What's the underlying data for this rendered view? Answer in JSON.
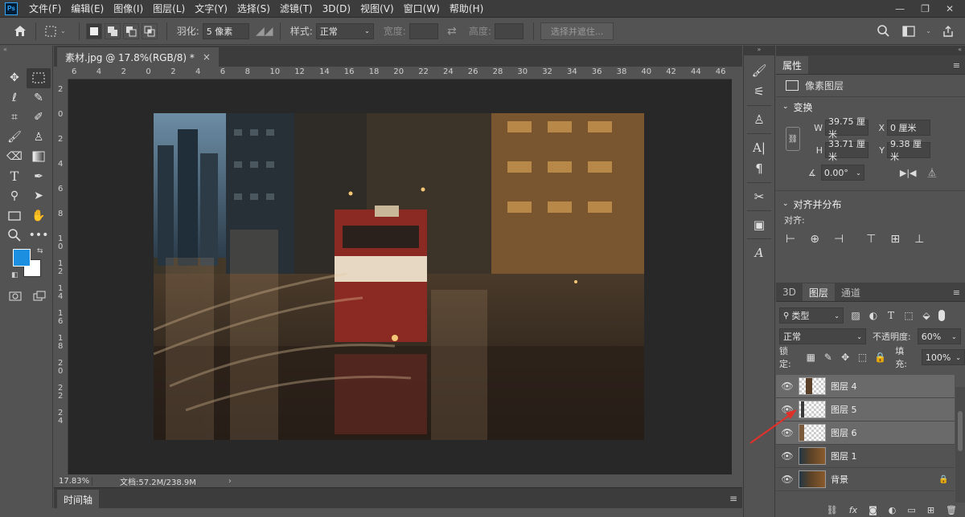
{
  "menubar": {
    "logo": "Ps",
    "items": [
      "文件(F)",
      "编辑(E)",
      "图像(I)",
      "图层(L)",
      "文字(Y)",
      "选择(S)",
      "滤镜(T)",
      "3D(D)",
      "视图(V)",
      "窗口(W)",
      "帮助(H)"
    ]
  },
  "options": {
    "feather_label": "羽化:",
    "feather_value": "5 像素",
    "style_label": "样式:",
    "style_value": "正常",
    "width_label": "宽度:",
    "height_label": "高度:",
    "select_mask_btn": "选择并遮住..."
  },
  "document": {
    "tab_title": "素材.jpg @ 17.8%(RGB/8) *",
    "tab_close": "×",
    "zoom": "17.83%",
    "doc_info": "文档:57.2M/238.9M",
    "ruler_h": [
      "6",
      "4",
      "2",
      "0",
      "2",
      "4",
      "6",
      "8",
      "10",
      "12",
      "14",
      "16",
      "18",
      "20",
      "22",
      "24",
      "26",
      "28",
      "30",
      "32",
      "34",
      "36",
      "38",
      "40",
      "42",
      "44",
      "46"
    ],
    "ruler_v": [
      "2",
      "0",
      "2",
      "4",
      "6",
      "8",
      "1 0",
      "1 2",
      "1 4",
      "1 6",
      "1 8",
      "2 0",
      "2 2",
      "2 4"
    ],
    "timeline_tab": "时间轴"
  },
  "properties": {
    "tab": "属性",
    "type_label": "像素图层",
    "transform_title": "变换",
    "w_label": "W",
    "w_value": "39.75 厘米",
    "h_label": "H",
    "h_value": "33.71 厘米",
    "x_label": "X",
    "x_value": "0 厘米",
    "y_label": "Y",
    "y_value": "9.38 厘米",
    "angle_value": "0.00°",
    "align_title": "对齐并分布",
    "align_label": "对齐:"
  },
  "layers": {
    "tabs": [
      "3D",
      "图层",
      "通道"
    ],
    "filter_value": "类型",
    "blend_mode": "正常",
    "opacity_label": "不透明度:",
    "opacity_value": "60%",
    "lock_label": "锁定:",
    "fill_label": "填充:",
    "fill_value": "100%",
    "items": [
      {
        "name": "图层 4"
      },
      {
        "name": "图层 5"
      },
      {
        "name": "图层 6"
      },
      {
        "name": "图层 1"
      },
      {
        "name": "背景"
      }
    ],
    "selected": [
      0,
      1,
      2
    ]
  },
  "colors": {
    "foreground": "#1d8fe0",
    "background": "#ffffff",
    "arrow": "#e0302a"
  }
}
